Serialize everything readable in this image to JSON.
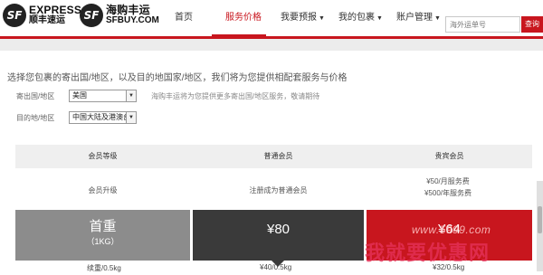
{
  "logo1": {
    "mark": "SF",
    "line1": "EXPRESS",
    "line2": "顺丰速运"
  },
  "logo2": {
    "mark": "SF",
    "line1": "海购丰运",
    "line2": "SFBUY.COM"
  },
  "nav": [
    {
      "label": "首页",
      "has_dropdown": false,
      "active": false
    },
    {
      "label": "服务价格",
      "has_dropdown": false,
      "active": true
    },
    {
      "label": "我要预报",
      "has_dropdown": true,
      "active": false
    },
    {
      "label": "我的包裹",
      "has_dropdown": true,
      "active": false
    },
    {
      "label": "账户管理",
      "has_dropdown": true,
      "active": false
    }
  ],
  "search": {
    "placeholder": "海外运单号",
    "button": "查询"
  },
  "intro": "选择您包裹的寄出国/地区，以及目的地国家/地区，我们将为您提供相配套服务与价格",
  "origin": {
    "label": "寄出国/地区",
    "value": "美国",
    "hint": "海购丰运将为您提供更多寄出国/地区服务，敬请期待"
  },
  "dest": {
    "label": "目的地/地区",
    "value": "中国大陆及港澳台"
  },
  "table": {
    "headers": [
      "会员等级",
      "普通会员",
      "贵宾会员"
    ],
    "row_upgrade": {
      "label": "会员升级",
      "normal": "注册成为普通会员",
      "vip": [
        "¥50/月服务费",
        "¥500/年服务费"
      ]
    },
    "first_weight": {
      "label": "首重",
      "unit": "（1KG）",
      "normal": "¥80",
      "vip": "¥64"
    },
    "continued": {
      "label": "续重/0.5kg",
      "normal": "¥40/0.5kg",
      "vip": "¥32/0.5kg"
    }
  },
  "watermark": {
    "url": "www.5999.com",
    "text": "我就要优惠网"
  },
  "colors": {
    "brand_red": "#c8161e",
    "dark": "#3a3a3a",
    "gray": "#8c8c8c"
  }
}
